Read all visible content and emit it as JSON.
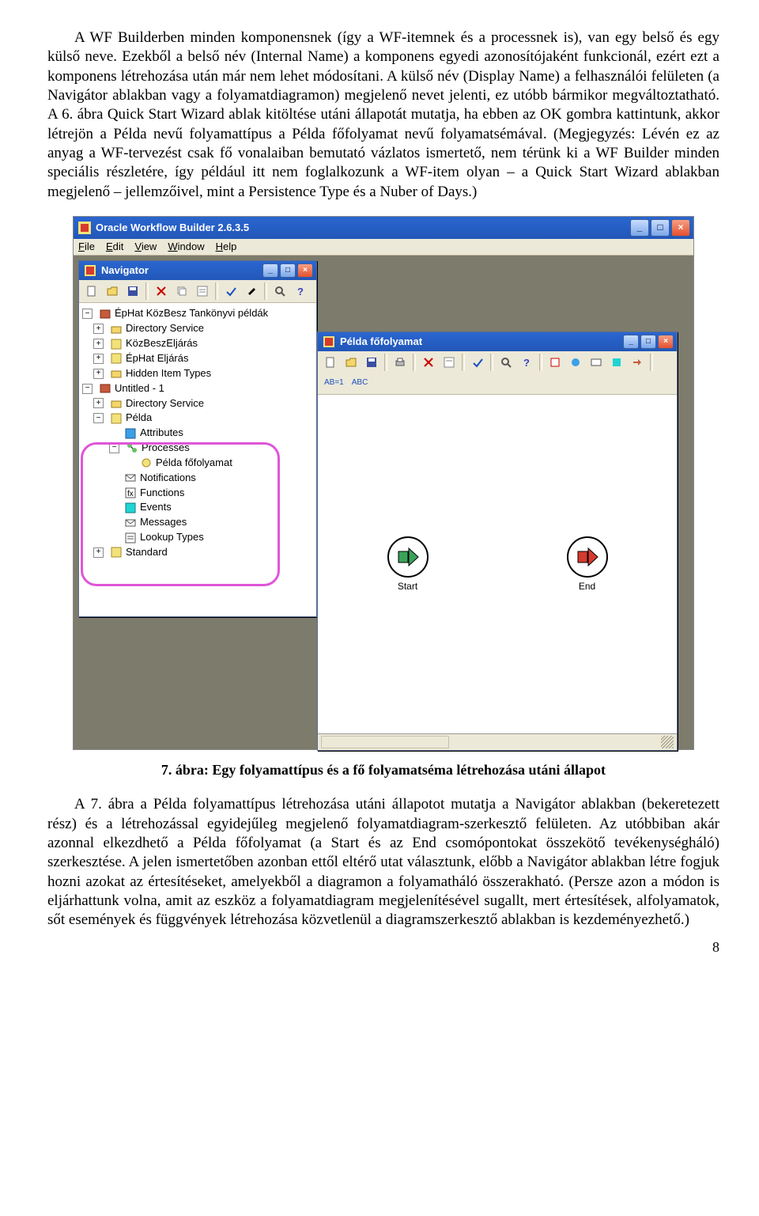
{
  "para1": "A WF Builderben minden komponensnek (így a WF-itemnek és a processnek is), van egy belső és egy külső neve. Ezekből a belső név (Internal Name) a komponens egyedi azonosítójaként funkcionál, ezért ezt a komponens létrehozása után már nem lehet módosítani. A külső név (Display Name) a felhasználói felületen (a Navigátor ablakban vagy a folyamatdiagramon) megjelenő nevet jelenti, ez utóbb bármikor megváltoztatható. A 6. ábra Quick Start Wizard ablak kitöltése utáni állapotát mutatja, ha ebben az OK gombra kattintunk, akkor létrejön a Példa nevű folyamattípus a Példa főfolyamat nevű folyamatsémával. (Megjegyzés: Lévén ez az anyag a WF-tervezést csak fő vonalaiban bemutató vázlatos ismertető, nem térünk ki a WF Builder minden speciális részletére, így például itt nem foglalkozunk a WF-item olyan – a Quick Start Wizard ablakban megjelenő – jellemzőivel, mint a Persistence Type és a Nuber of Days.)",
  "caption": "7. ábra: Egy folyamattípus és a fő folyamatséma létrehozása utáni állapot",
  "para2": "A 7. ábra a Példa folyamattípus létrehozása utáni állapotot mutatja a Navigátor ablakban (bekeretezett rész) és a létrehozással egyidejűleg megjelenő folyamatdiagram-szerkesztő felületen. Az utóbbiban akár azonnal elkezdhető a Példa főfolyamat (a Start és az End csomópontokat összekötő tevékenységháló) szerkesztése. A jelen ismertetőben azonban ettől eltérő utat választunk, előbb a Navigátor ablakban létre fogjuk hozni azokat az értesítéseket, amelyekből a diagramon a folyamatháló összerakható. (Persze azon a módon is eljárhattunk volna, amit az eszköz a folyamatdiagram megjelenítésével sugallt, mert értesítések, alfolyamatok, sőt események és függvények létrehozása közvetlenül a diagramszerkesztő ablakban is kezdeményezhető.)",
  "pagenum": "8",
  "app": {
    "title": "Oracle Workflow Builder 2.6.3.5",
    "menu": {
      "file": "File",
      "edit": "Edit",
      "view": "View",
      "window": "Window",
      "help": "Help"
    }
  },
  "nav": {
    "title": "Navigator",
    "items": {
      "root1": "ÉpHat KözBesz Tankönyvi példák",
      "ds1": "Directory Service",
      "kbe": "KözBeszEljárás",
      "ehe": "ÉpHat Eljárás",
      "hit": "Hidden Item Types",
      "root2": "Untitled - 1",
      "ds2": "Directory Service",
      "pelda": "Példa",
      "attr": "Attributes",
      "proc": "Processes",
      "pff": "Példa főfolyamat",
      "notif": "Notifications",
      "func": "Functions",
      "events": "Events",
      "msgs": "Messages",
      "lut": "Lookup Types",
      "std": "Standard"
    }
  },
  "diag": {
    "title": "Példa főfolyamat",
    "start": "Start",
    "end": "End",
    "ab1": "AB=1",
    "abc": "ABC"
  }
}
